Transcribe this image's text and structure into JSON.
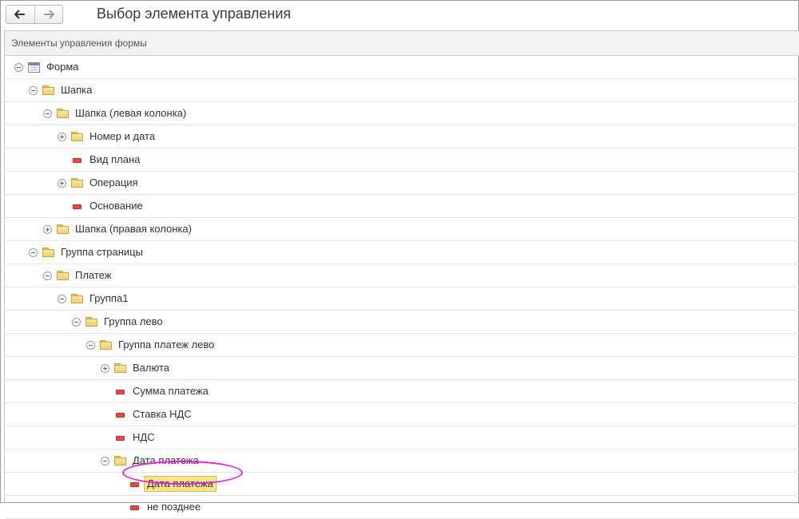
{
  "window": {
    "title": "Выбор элемента управления"
  },
  "nav": {
    "back_icon": "arrow-left-icon",
    "forward_icon": "arrow-right-icon"
  },
  "panel": {
    "header": "Элементы управления формы"
  },
  "tree": [
    {
      "label": "Форма",
      "level": 0,
      "toggle": "minus",
      "icon": "form",
      "selected": false
    },
    {
      "label": "Шапка",
      "level": 1,
      "toggle": "minus",
      "icon": "folder",
      "selected": false
    },
    {
      "label": "Шапка (левая колонка)",
      "level": 2,
      "toggle": "minus",
      "icon": "folder",
      "selected": false
    },
    {
      "label": "Номер и дата",
      "level": 3,
      "toggle": "plus",
      "icon": "folder",
      "selected": false
    },
    {
      "label": "Вид плана",
      "level": 3,
      "toggle": "none",
      "icon": "field",
      "selected": false
    },
    {
      "label": "Операция",
      "level": 3,
      "toggle": "plus",
      "icon": "folder",
      "selected": false
    },
    {
      "label": "Основание",
      "level": 3,
      "toggle": "none",
      "icon": "field",
      "selected": false
    },
    {
      "label": "Шапка (правая колонка)",
      "level": 2,
      "toggle": "plus",
      "icon": "folder",
      "selected": false
    },
    {
      "label": "Группа страницы",
      "level": 1,
      "toggle": "minus",
      "icon": "folder",
      "selected": false
    },
    {
      "label": "Платеж",
      "level": 2,
      "toggle": "minus",
      "icon": "folder",
      "selected": false
    },
    {
      "label": "Группа1",
      "level": 3,
      "toggle": "minus",
      "icon": "folder",
      "selected": false
    },
    {
      "label": "Группа лево",
      "level": 4,
      "toggle": "minus",
      "icon": "folder",
      "selected": false
    },
    {
      "label": "Группа платеж лево",
      "level": 5,
      "toggle": "minus",
      "icon": "folder",
      "selected": false
    },
    {
      "label": "Валюта",
      "level": 6,
      "toggle": "plus",
      "icon": "folder",
      "selected": false
    },
    {
      "label": "Сумма платежа",
      "level": 6,
      "toggle": "none",
      "icon": "field",
      "selected": false
    },
    {
      "label": "Ставка НДС",
      "level": 6,
      "toggle": "none",
      "icon": "field",
      "selected": false
    },
    {
      "label": "НДС",
      "level": 6,
      "toggle": "none",
      "icon": "field",
      "selected": false
    },
    {
      "label": "Дата платежа",
      "level": 6,
      "toggle": "minus",
      "icon": "folder",
      "selected": false
    },
    {
      "label": "Дата платежа",
      "level": 7,
      "toggle": "none",
      "icon": "field",
      "selected": true
    },
    {
      "label": "не позднее",
      "level": 7,
      "toggle": "none",
      "icon": "field",
      "selected": false
    }
  ],
  "colors": {
    "highlight_ellipse": "#e51fe5",
    "selection_fill": "#fde58e",
    "field_marker": "#e54a3c"
  }
}
